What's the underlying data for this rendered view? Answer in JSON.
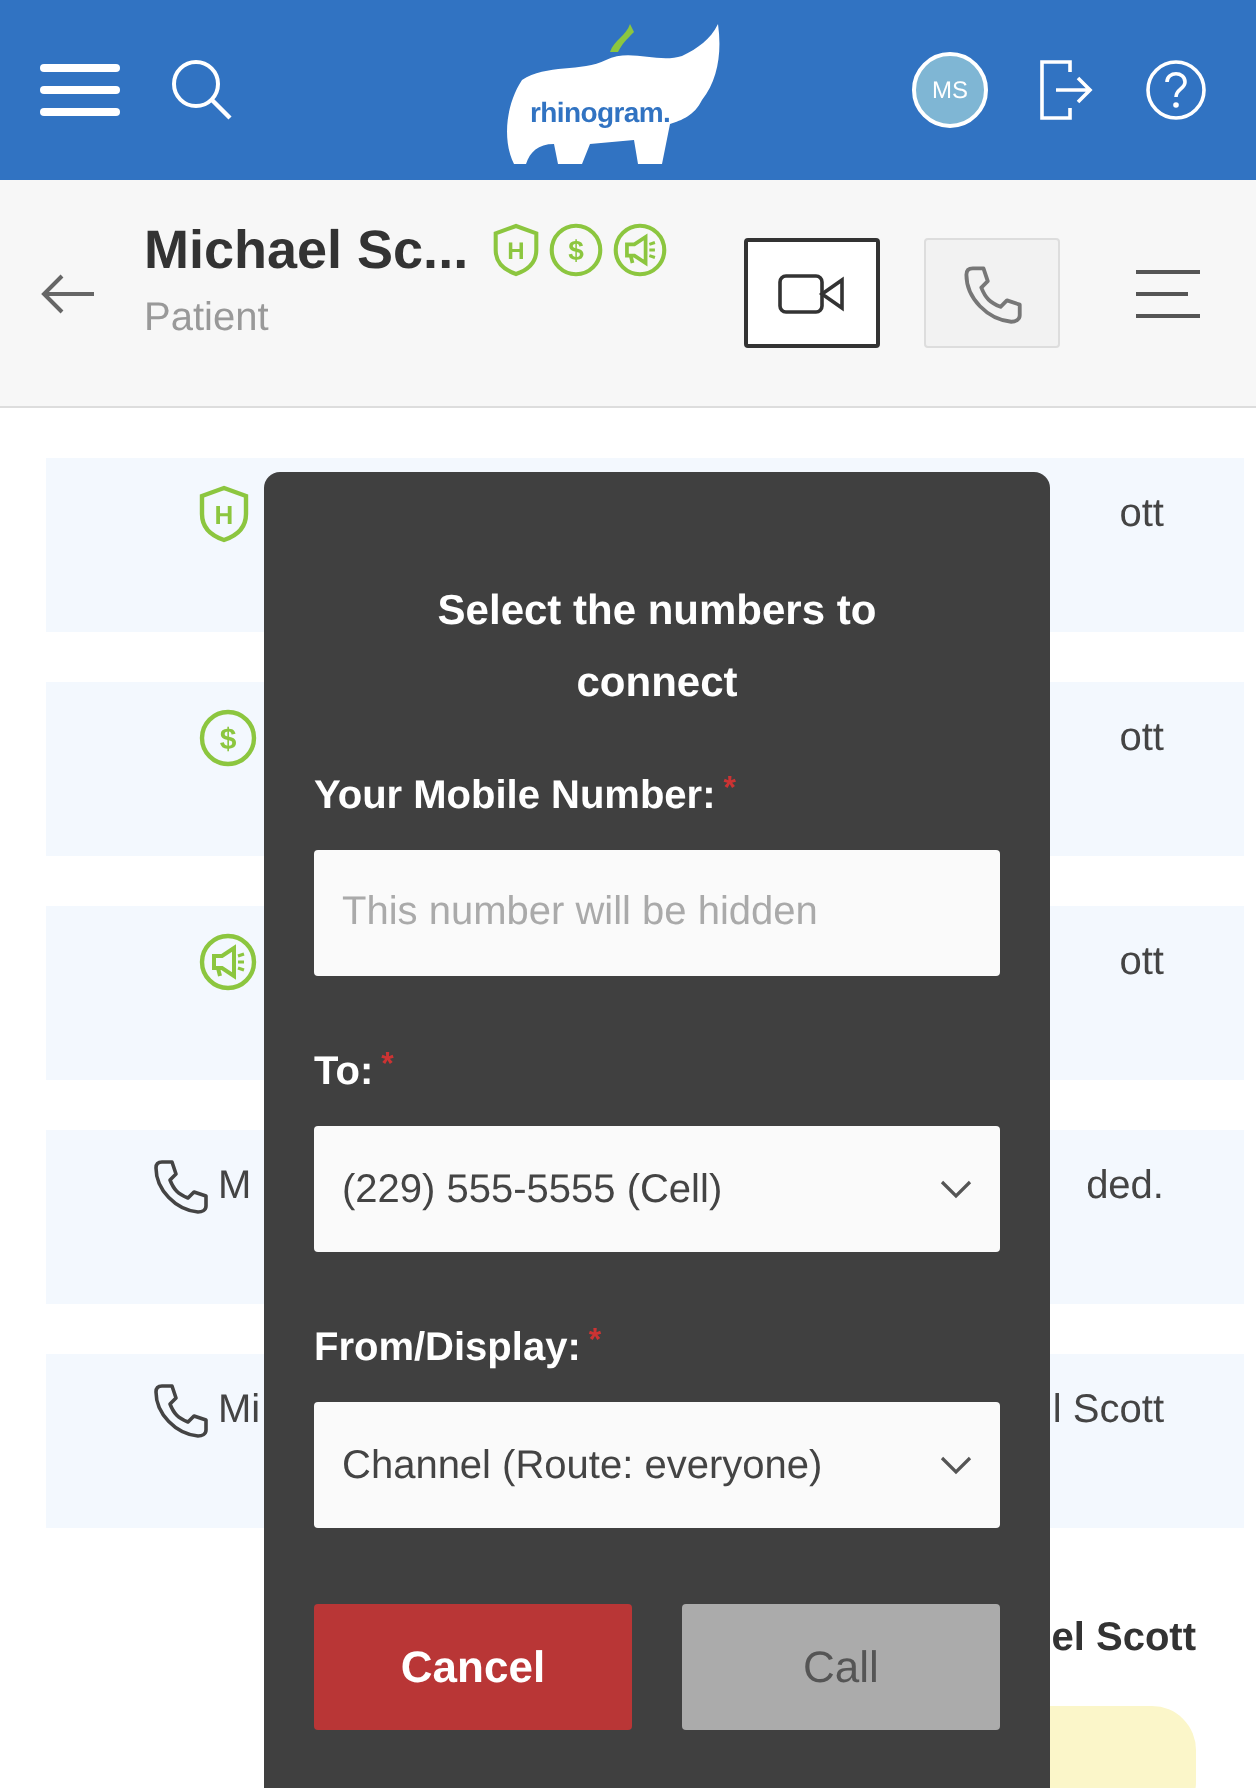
{
  "top_bar": {
    "logo": "rhinogram.",
    "avatar": "MS"
  },
  "contact": {
    "name": "Michael Sc...",
    "role": "Patient",
    "badges": [
      {
        "kind": "hipaa",
        "label": "H"
      },
      {
        "kind": "payment",
        "label": "$"
      },
      {
        "kind": "marketing"
      }
    ]
  },
  "call_buttons": [
    {
      "kind": "video",
      "selected": false
    },
    {
      "kind": "phone",
      "selected": true
    }
  ],
  "events": [
    {
      "kind": "hipaa",
      "icon_label": "H",
      "right_text": "ott"
    },
    {
      "kind": "payment",
      "icon_label": "$",
      "right_text": "ott"
    },
    {
      "kind": "marketing",
      "right_text": "ott"
    },
    {
      "kind": "phone",
      "left_text": "M",
      "right_text": "ded."
    },
    {
      "kind": "phone",
      "left_text": "Mi",
      "right_text": "l Scott"
    }
  ],
  "sender": "el Scott",
  "dialog": {
    "title": "Select the numbers to connect",
    "fields": [
      {
        "kind": "input",
        "label": "Your Mobile Number:",
        "required_mark": "*",
        "placeholder": "This number will be hidden"
      },
      {
        "kind": "select",
        "label": "To:",
        "required_mark": "*",
        "value": "(229) 555-5555 (Cell)"
      },
      {
        "kind": "select",
        "label": "From/Display:",
        "required_mark": "*",
        "value": "Channel (Route: everyone)"
      }
    ],
    "buttons": [
      {
        "kind": "cancel",
        "label": "Cancel",
        "disabled": false
      },
      {
        "kind": "confirm",
        "label": "Call",
        "disabled": true
      }
    ]
  }
}
